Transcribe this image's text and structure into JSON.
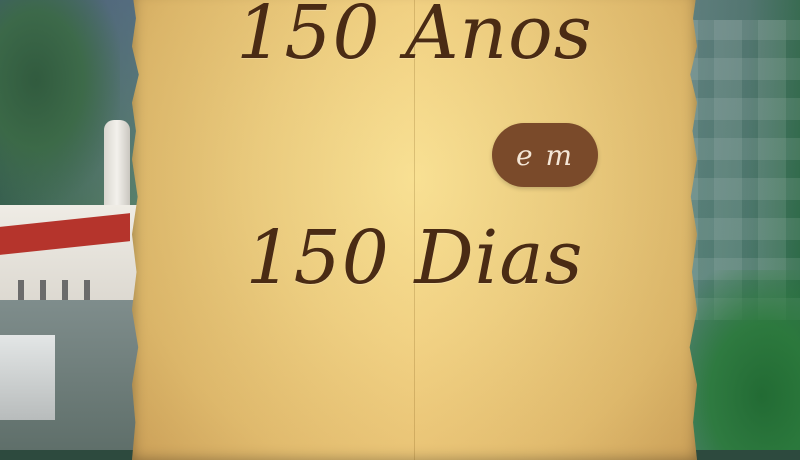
{
  "poster": {
    "title_line1": "150 Anos",
    "connector": "e m",
    "title_line2": "150 Dias"
  },
  "theme": {
    "parchment": "#f1d07f",
    "text_brown": "#4a2b14",
    "pill_brown": "#7a4a2a",
    "pill_text": "#f4e6d6"
  }
}
